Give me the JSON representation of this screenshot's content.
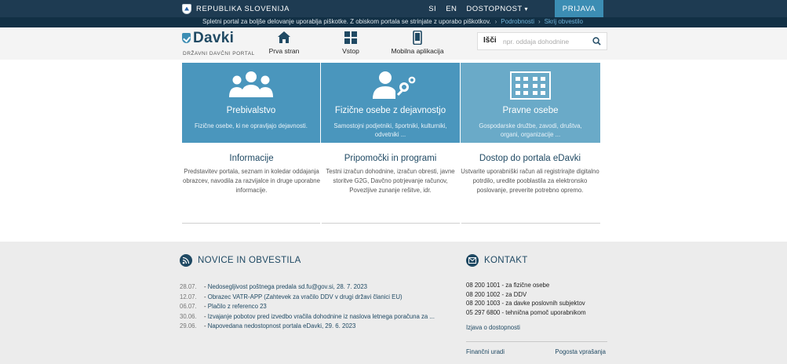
{
  "topbar": {
    "country": "REPUBLIKA SLOVENIJA",
    "links": [
      "SI",
      "EN"
    ],
    "accessibility": "DOSTOPNOST",
    "login": "PRIJAVA"
  },
  "cookie": {
    "text": "Spletni portal za boljše delovanje uporablja piškotke. Z obiskom portala se strinjate z uporabo piškotkov.",
    "details": "Podrobnosti",
    "hide": "Skrij obvestilo"
  },
  "header": {
    "logo_name": "Davki",
    "logo_sub": "DRŽAVNI DAVČNI PORTAL",
    "nav": [
      {
        "label": "Prva stran",
        "icon": "home-icon"
      },
      {
        "label": "Vstop",
        "icon": "grid-icon"
      },
      {
        "label": "Mobilna aplikacija",
        "icon": "mobile-icon"
      }
    ],
    "search_label": "Išči",
    "search_placeholder": "npr. oddaja dohodnine"
  },
  "tiles": [
    {
      "title": "Prebivalstvo",
      "desc": "Fizične osebe, ki ne opravljajo dejavnosti.",
      "color": "#4a96bd"
    },
    {
      "title": "Fizične osebe z dejavnostjo",
      "desc": "Samostojni podjetniki, športniki, kulturniki, odvetniki ...",
      "color": "#4a96bd"
    },
    {
      "title": "Pravne osebe",
      "desc": "Gospodarske družbe, zavodi, društva, organi, organizacije ...",
      "color": "#6aaac8"
    }
  ],
  "info": [
    {
      "title": "Informacije",
      "desc": "Predstavitev portala, seznam in koledar oddajanja obrazcev, navodila za razvijalce in druge uporabne informacije."
    },
    {
      "title": "Pripomočki in programi",
      "desc": "Testni izračun dohodnine, izračun obresti, javne storitve G2G, Davčno potrjevanje računov, Povezljive zunanje rešitve, idr."
    },
    {
      "title": "Dostop do portala eDavki",
      "desc": "Ustvarite uporabniški račun ali registrirajte digitalno potrdilo, uredite pooblastila za elektronsko poslovanje, preverite potrebno opremo."
    }
  ],
  "news": {
    "title": "NOVICE IN OBVESTILA",
    "items": [
      {
        "date": "28.07.",
        "text": "Nedosegljivost poštnega predala sd.fu@gov.si, 28. 7. 2023"
      },
      {
        "date": "12.07.",
        "text": "Obrazec VATR-APP (Zahtevek za vračilo DDV v drugi državi članici EU)"
      },
      {
        "date": "06.07.",
        "text": "Plačilo z referenco 23"
      },
      {
        "date": "30.06.",
        "text": "Izvajanje pobotov pred izvedbo vračila dohodnine iz naslova letnega poračuna za ..."
      },
      {
        "date": "29.06.",
        "text": "Napovedana nedostopnost portala eDavki, 29. 6. 2023"
      }
    ]
  },
  "contact": {
    "title": "KONTAKT",
    "lines": [
      "08 200 1001 - za fizične osebe",
      "08 200 1002 - za DDV",
      "08 200 1003 - za davke poslovnih subjektov",
      "05 297 6800 - tehnična pomoč uporabnikom"
    ],
    "accessibility_statement": "Izjava o dostopnosti",
    "footer_left": "Finančni uradi",
    "footer_right": "Pogosta vprašanja"
  },
  "colors": {
    "topbar": "#1e3b52",
    "accent": "#3c8db3",
    "brand_dark": "#1f4963"
  }
}
